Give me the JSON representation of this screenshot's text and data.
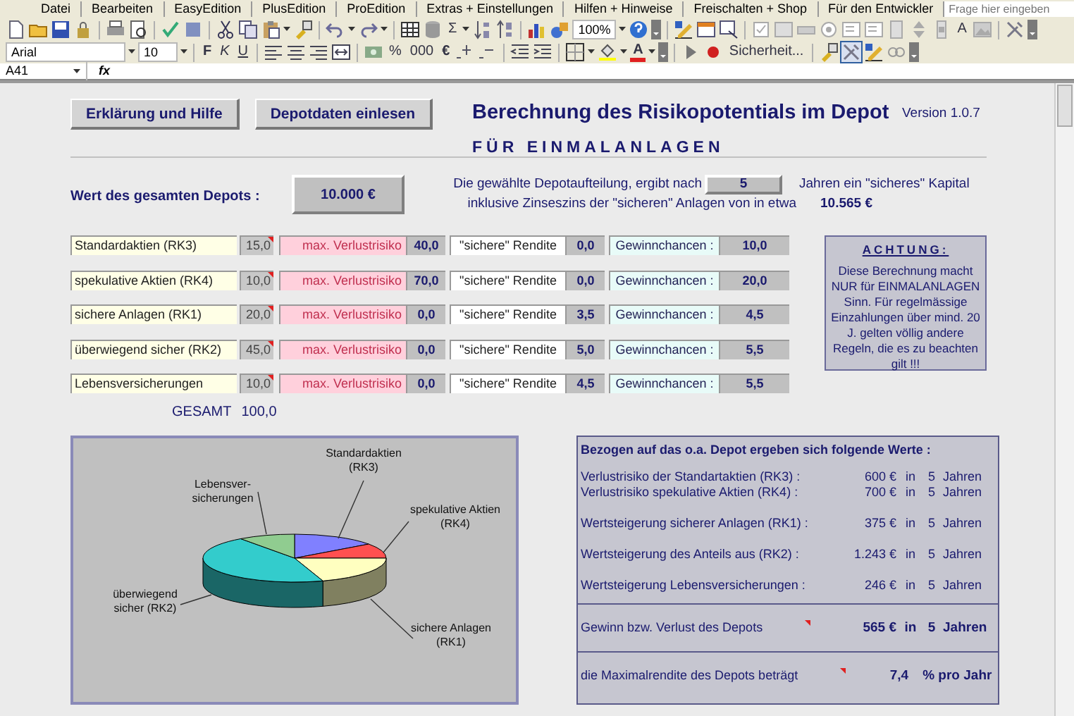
{
  "menu": [
    "Datei",
    "Bearbeiten",
    "EasyEdition",
    "PlusEdition",
    "ProEdition",
    "Extras + Einstellungen",
    "Hilfen + Hinweise",
    "Freischalten + Shop",
    "Für den Entwickler"
  ],
  "help_search": {
    "placeholder": "Frage hier eingeben"
  },
  "toolbar1": {
    "sum": "Σ",
    "zoom": "100%",
    "label_tool": "A"
  },
  "toolbar2": {
    "font": "Arial",
    "size": "10",
    "bold": "F",
    "italic": "K",
    "underline": "U",
    "percent": "%",
    "thousands": "000",
    "euro": "€",
    "font_color": "A",
    "macro_security": "Sicherheit...",
    "tools_pressed": true
  },
  "formula_bar": {
    "cell": "A41",
    "fx": "fx"
  },
  "buttons": [
    "Erklärung und Hilfe",
    "Depotdaten einlesen"
  ],
  "title": "Berechnung des Risikopotentials im Depot",
  "subtitle": "FÜR EINMALANLAGEN",
  "version": "Version 1.0.7",
  "depot": {
    "label": "Wert des gesamten Depots :",
    "value": "10.000 €"
  },
  "summary": {
    "text_before": "Die gewählte Depotaufteilung, ergibt nach",
    "years": "5",
    "text_after": "Jahren ein \"sicheres\" Kapital",
    "text_line2": "inklusive Zinseszins der \"sicheren\" Anlagen von in etwa",
    "capital": "10.565 €"
  },
  "rows": [
    {
      "name": "Standardaktien (RK3)",
      "share": "15,0",
      "comment": true,
      "risk_label": "max. Verlustrisiko",
      "risk": "40,0",
      "yield_label": "\"sichere\" Rendite",
      "yield": "0,0",
      "chance_label": "Gewinnchancen :",
      "chance": "10,0"
    },
    {
      "name": "spekulative Aktien (RK4)",
      "share": "10,0",
      "comment": true,
      "risk_label": "max. Verlustrisiko",
      "risk": "70,0",
      "yield_label": "\"sichere\" Rendite",
      "yield": "0,0",
      "chance_label": "Gewinnchancen :",
      "chance": "20,0"
    },
    {
      "name": "sichere Anlagen (RK1)",
      "share": "20,0",
      "comment": true,
      "risk_label": "max. Verlustrisiko",
      "risk": "0,0",
      "yield_label": "\"sichere\" Rendite",
      "yield": "3,5",
      "chance_label": "Gewinnchancen :",
      "chance": "4,5"
    },
    {
      "name": "überwiegend sicher (RK2)",
      "share": "45,0",
      "comment": true,
      "risk_label": "max. Verlustrisiko",
      "risk": "0,0",
      "yield_label": "\"sichere\" Rendite",
      "yield": "5,0",
      "chance_label": "Gewinnchancen :",
      "chance": "5,5"
    },
    {
      "name": "Lebensversicherungen",
      "share": "10,0",
      "comment": true,
      "risk_label": "max. Verlustrisiko",
      "risk": "0,0",
      "yield_label": "\"sichere\" Rendite",
      "yield": "4,5",
      "chance_label": "Gewinnchancen :",
      "chance": "5,5"
    }
  ],
  "total": {
    "label": "GESAMT",
    "value": "100,0"
  },
  "notice": {
    "heading": "ACHTUNG:",
    "text": "Diese Berechnung macht NUR für EINMALANLAGEN Sinn. Für regelmässige Einzahlungen über mind. 20 J. gelten völlig andere Regeln, die es zu beachten gilt !!!"
  },
  "pie": {
    "slices": [
      {
        "label": [
          "Standardaktien",
          "(RK3)"
        ],
        "color": "#8080ff"
      },
      {
        "label": [
          "spekulative Aktien",
          "(RK4)"
        ],
        "color": "#ff5050"
      },
      {
        "label": [
          "sichere Anlagen",
          "(RK1)"
        ],
        "color": "#ffffc0"
      },
      {
        "label": [
          "überwiegend",
          "sicher (RK2)"
        ],
        "color": "#33cccc"
      },
      {
        "label": [
          "Lebensver-",
          "sicherungen"
        ],
        "color": "#90cc90"
      }
    ]
  },
  "results": {
    "heading": "Bezogen auf das o.a. Depot ergeben sich folgende Werte :",
    "groups": [
      [
        {
          "label": "Verlustrisiko der Standartaktien (RK3) :",
          "amount": "600 €",
          "in": "in",
          "years": "5",
          "unit": "Jahren"
        },
        {
          "label": "Verlustrisiko spekulative Aktien (RK4) :",
          "amount": "700 €",
          "in": "in",
          "years": "5",
          "unit": "Jahren"
        }
      ],
      [
        {
          "label": "Wertsteigerung sicherer Anlagen (RK1) :",
          "amount": "375 €",
          "in": "in",
          "years": "5",
          "unit": "Jahren"
        }
      ],
      [
        {
          "label": "Wertsteigerung des Anteils aus (RK2) :",
          "amount": "1.243 €",
          "in": "in",
          "years": "5",
          "unit": "Jahren"
        }
      ],
      [
        {
          "label": "Wertsteigerung Lebensversicherungen :",
          "amount": "246 €",
          "in": "in",
          "years": "5",
          "unit": "Jahren"
        }
      ]
    ],
    "total": {
      "label": "Gewinn bzw. Verlust des Depots",
      "comment": true,
      "amount": "565 €",
      "in": "in",
      "years": "5",
      "unit": "Jahren"
    },
    "max": {
      "label": "die Maximalrendite des Depots beträgt",
      "comment": true,
      "value": "7,4",
      "unit": "% pro Jahr"
    }
  }
}
